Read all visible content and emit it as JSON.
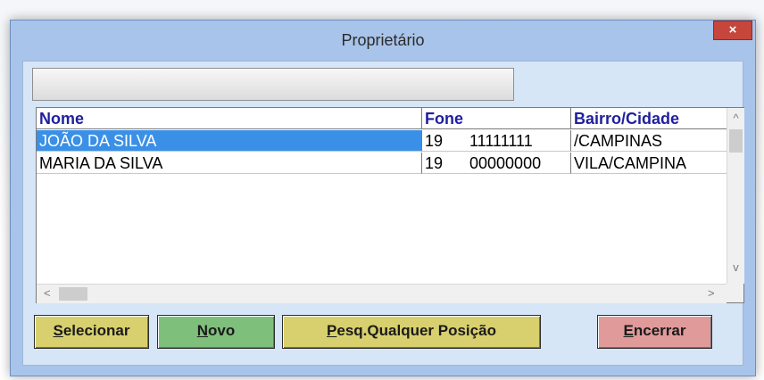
{
  "window": {
    "title": "Proprietário",
    "close_label": "×"
  },
  "search": {
    "value": "",
    "placeholder": ""
  },
  "grid": {
    "columns": [
      "Nome",
      "Fone",
      "Bairro/Cidade"
    ],
    "rows": [
      {
        "nome": "JOÃO DA SILVA",
        "ddd": "19",
        "fone": "11111111",
        "bairro": "/CAMPINAS",
        "selected": true
      },
      {
        "nome": "MARIA DA SILVA",
        "ddd": "19",
        "fone": "00000000",
        "bairro": "VILA/CAMPINA",
        "selected": false
      }
    ]
  },
  "scroll": {
    "up": "^",
    "down": "v",
    "left": "<",
    "right": ">"
  },
  "buttons": {
    "selecionar": {
      "first": "S",
      "rest": "elecionar"
    },
    "novo": {
      "first": "N",
      "rest": "ovo"
    },
    "pesq": {
      "first": "P",
      "rest": "esq.Qualquer Posição"
    },
    "encerrar": {
      "first": "E",
      "rest": "ncerrar"
    }
  },
  "colors": {
    "frame": "#a9c4ea",
    "client": "#d6e6f7",
    "selection": "#3a90e6",
    "header_text": "#1f1fa0",
    "btn_yellow": "#d8d06e",
    "btn_green": "#7fbf7c",
    "btn_red": "#e09a9a",
    "close": "#c7463b"
  }
}
